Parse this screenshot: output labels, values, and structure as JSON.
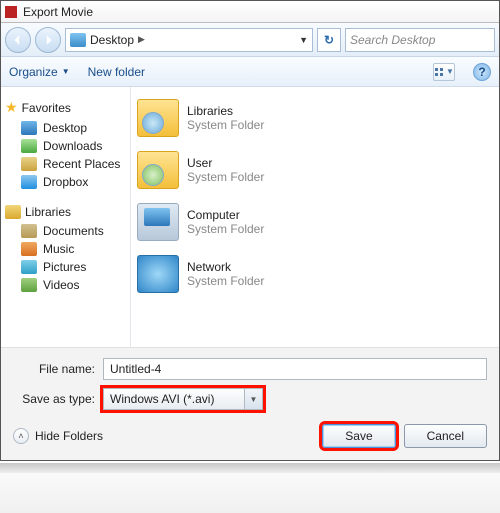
{
  "title": "Export Movie",
  "breadcrumb": {
    "location": "Desktop"
  },
  "search": {
    "placeholder": "Search Desktop"
  },
  "toolbar": {
    "organize": "Organize",
    "newfolder": "New folder"
  },
  "sidebar": {
    "favorites": "Favorites",
    "items_fav": [
      {
        "label": "Desktop"
      },
      {
        "label": "Downloads"
      },
      {
        "label": "Recent Places"
      },
      {
        "label": "Dropbox"
      }
    ],
    "libraries": "Libraries",
    "items_lib": [
      {
        "label": "Documents"
      },
      {
        "label": "Music"
      },
      {
        "label": "Pictures"
      },
      {
        "label": "Videos"
      }
    ]
  },
  "content": {
    "items": [
      {
        "name": "Libraries",
        "sub": "System Folder"
      },
      {
        "name": "User",
        "sub": "System Folder"
      },
      {
        "name": "Computer",
        "sub": "System Folder"
      },
      {
        "name": "Network",
        "sub": "System Folder"
      }
    ]
  },
  "filename_label": "File name:",
  "filename_value": "Untitled-4",
  "savetype_label": "Save as type:",
  "savetype_value": "Windows AVI (*.avi)",
  "hide_folders": "Hide Folders",
  "buttons": {
    "save": "Save",
    "cancel": "Cancel"
  }
}
